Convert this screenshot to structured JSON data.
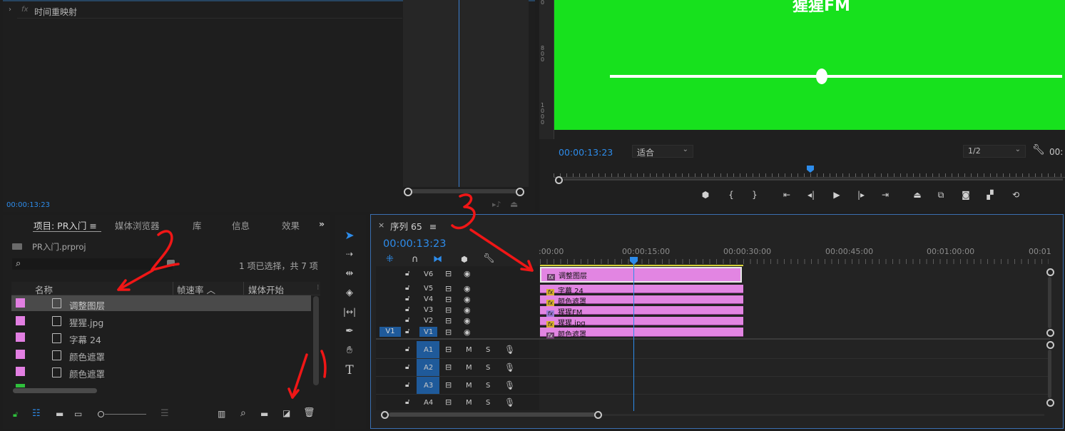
{
  "effect_controls": {
    "row_label": "时间重映射",
    "timecode": "00:00:13:23"
  },
  "program": {
    "video_title": "猩猩FM",
    "timecode": "00:00:13:23",
    "fit_label": "适合",
    "resolution": "1/2",
    "right_timecode": "00:"
  },
  "project": {
    "tabs": [
      "项目: PR入门",
      "媒体浏览器",
      "库",
      "信息",
      "效果"
    ],
    "file_name": "PR入门.prproj",
    "selection_status": "1 项已选择，共 7 项",
    "columns": [
      "名称",
      "帧速率",
      "媒体开始"
    ],
    "items": [
      {
        "name": "调整图层",
        "color": "#e27fe2"
      },
      {
        "name": "猩猩.jpg",
        "color": "#e27fe2"
      },
      {
        "name": "字幕 24",
        "color": "#e27fe2"
      },
      {
        "name": "颜色遮罩",
        "color": "#e27fe2"
      },
      {
        "name": "颜色遮罩",
        "color": "#e27fe2"
      }
    ]
  },
  "timeline": {
    "sequence_name": "序列 65",
    "timecode": "00:00:13:23",
    "ruler": [
      ":00:00",
      "00:00:15:00",
      "00:00:30:00",
      "00:00:45:00",
      "00:01:00:00",
      "00:01"
    ],
    "video_tracks": [
      "V6",
      "V5",
      "V4",
      "V3",
      "V2",
      "V1"
    ],
    "audio_tracks": [
      "A1",
      "A2",
      "A3",
      "A4"
    ],
    "source_patch": "V1",
    "audio_mute": "M",
    "audio_solo": "S",
    "clips": [
      {
        "track": "V6",
        "label": "调整图层",
        "badge": "fx"
      },
      {
        "track": "V5",
        "label": "字幕 24",
        "badge": "fx"
      },
      {
        "track": "V4",
        "label": "颜色遮罩",
        "badge": "fx"
      },
      {
        "track": "V3",
        "label": "猩猩FM",
        "badge": "fx"
      },
      {
        "track": "V2",
        "label": "猩猩.jpg",
        "badge": "fx"
      },
      {
        "track": "V1",
        "label": "颜色遮罩",
        "badge": "fx"
      }
    ]
  },
  "annotations": [
    "2",
    "3",
    "1"
  ],
  "colors": {
    "accent_blue": "#2d8ceb",
    "clip_pink": "#e285e2",
    "green_screen": "#17e11d",
    "annotation_red": "#f01616"
  }
}
